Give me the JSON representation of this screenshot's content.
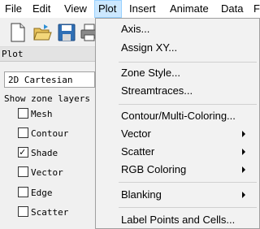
{
  "menubar": {
    "items": [
      {
        "label": "File"
      },
      {
        "label": "Edit"
      },
      {
        "label": "View"
      },
      {
        "label": "Plot"
      },
      {
        "label": "Insert"
      },
      {
        "label": "Animate"
      },
      {
        "label": "Data"
      },
      {
        "label": "F"
      }
    ]
  },
  "toolbar": {
    "icons": [
      "new-document-icon",
      "open-folder-icon",
      "save-icon",
      "print-icon"
    ]
  },
  "side_panel": {
    "title": "Plot",
    "frame_mode": "2D Cartesian",
    "zone_layers_label": "Show zone layers",
    "layers": [
      {
        "label": "Mesh",
        "checked": false
      },
      {
        "label": "Contour",
        "checked": false
      },
      {
        "label": "Shade",
        "checked": true,
        "check_glyph": "✓"
      },
      {
        "label": "Vector",
        "checked": false
      },
      {
        "label": "Edge",
        "checked": false
      },
      {
        "label": "Scatter",
        "checked": false
      }
    ]
  },
  "plot_menu": {
    "items": [
      {
        "label": "Axis...",
        "submenu": false
      },
      {
        "label": "Assign XY...",
        "submenu": false
      },
      {
        "label": "Zone Style...",
        "submenu": false
      },
      {
        "label": "Streamtraces...",
        "submenu": false
      },
      {
        "label": "Contour/Multi-Coloring...",
        "submenu": false
      },
      {
        "label": "Vector",
        "submenu": true
      },
      {
        "label": "Scatter",
        "submenu": true
      },
      {
        "label": "RGB Coloring",
        "submenu": true
      },
      {
        "label": "Blanking",
        "submenu": true
      },
      {
        "label": "Label Points and Cells...",
        "submenu": false
      }
    ]
  },
  "colors": {
    "menu_highlight": "#cce8ff",
    "menu_background": "#f2f2f2",
    "window_background": "#f0f0f0"
  }
}
